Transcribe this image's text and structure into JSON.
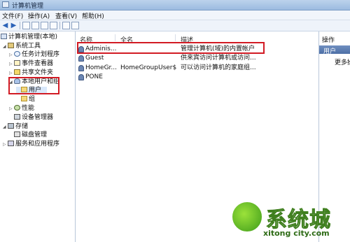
{
  "window": {
    "title": "计算机管理"
  },
  "menubar": {
    "items": [
      "文件(F)",
      "操作(A)",
      "查看(V)",
      "帮助(H)"
    ]
  },
  "tree": {
    "root": "计算机管理(本地)",
    "system_tools": "系统工具",
    "task_scheduler": "任务计划程序",
    "event_viewer": "事件查看器",
    "shared_folders": "共享文件夹",
    "local_users_groups": "本地用户和组",
    "users": "用户",
    "groups": "组",
    "performance": "性能",
    "device_manager": "设备管理器",
    "storage": "存储",
    "disk_management": "磁盘管理",
    "services_apps": "服务和应用程序"
  },
  "list": {
    "columns": [
      "名称",
      "全名",
      "描述"
    ],
    "rows": [
      {
        "name": "Adminis...",
        "fullname": "",
        "description": "管理计算机(域)的内置帐户"
      },
      {
        "name": "Guest",
        "fullname": "",
        "description": "供来宾访问计算机或访问..."
      },
      {
        "name": "HomeGr...",
        "fullname": "HomeGroupUser$",
        "description": "可以访问计算机的家庭组..."
      },
      {
        "name": "PONE",
        "fullname": "",
        "description": ""
      }
    ]
  },
  "actions": {
    "header": "操作",
    "section": "用户",
    "more": "更多操"
  },
  "watermark": {
    "text": "系统城",
    "url": "xitong city.com"
  },
  "colors": {
    "highlight_box": "#d21b24",
    "actions_bar": "#4d6fa6",
    "selection": "#d9e8fb"
  }
}
